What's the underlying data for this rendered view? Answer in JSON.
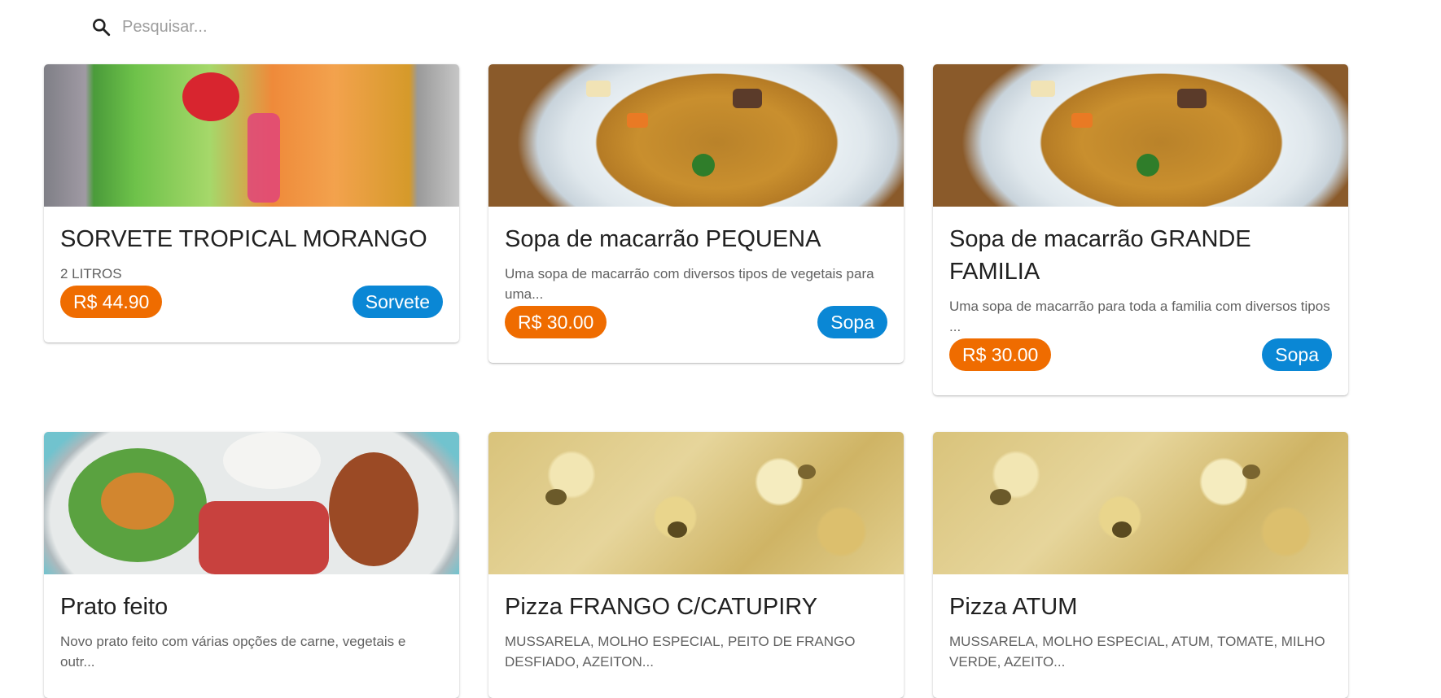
{
  "search": {
    "placeholder": "Pesquisar..."
  },
  "cards": [
    {
      "title": "SORVETE TROPICAL MORANGO",
      "description": "2 LITROS",
      "price": "R$ 44.90",
      "category": "Sorvete"
    },
    {
      "title": "Sopa de macarrão PEQUENA",
      "description": "Uma sopa de macarrão com diversos tipos de vegetais para uma...",
      "price": "R$ 30.00",
      "category": "Sopa"
    },
    {
      "title": "Sopa de macarrão GRANDE FAMILIA",
      "description": "Uma sopa de macarrão para toda a familia com diversos tipos ...",
      "price": "R$ 30.00",
      "category": "Sopa"
    },
    {
      "title": "Prato feito",
      "description": "Novo prato feito com várias opções de carne, vegetais e outr..."
    },
    {
      "title": "Pizza FRANGO C/CATUPIRY",
      "description": "MUSSARELA, MOLHO ESPECIAL, PEITO DE FRANGO DESFIADO, AZEITON..."
    },
    {
      "title": "Pizza ATUM",
      "description": "MUSSARELA, MOLHO ESPECIAL, ATUM, TOMATE, MILHO VERDE, AZEITO..."
    }
  ],
  "colors": {
    "price_chip": "#ef6c00",
    "category_chip": "#0a87d5"
  },
  "icons": {
    "search": "search-icon"
  }
}
